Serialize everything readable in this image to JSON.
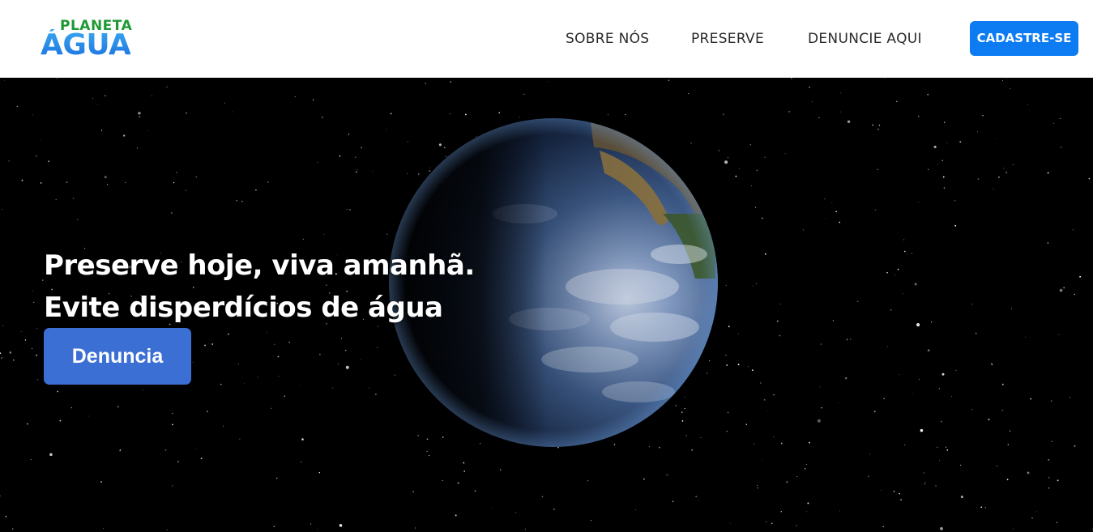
{
  "brand": {
    "logo_top": "PLANETA",
    "logo_bottom": "ÁGUA",
    "colors": {
      "green": "#1e9a34",
      "blue": "#1a6fe0"
    }
  },
  "nav": {
    "items": [
      {
        "label": "SOBRE NÓS"
      },
      {
        "label": "PRESERVE"
      },
      {
        "label": "DENUNCIE AQUI"
      }
    ],
    "cta_label": "CADASTRE-SE",
    "cta_color": "#0d7bf2"
  },
  "hero": {
    "headline_line1": "Preserve hoje, viva amanhã.",
    "headline_line2": "Evite disperdícios de água",
    "button_label": "Denuncia",
    "button_color": "#3b6fd4",
    "background_image": "earth-from-space"
  }
}
